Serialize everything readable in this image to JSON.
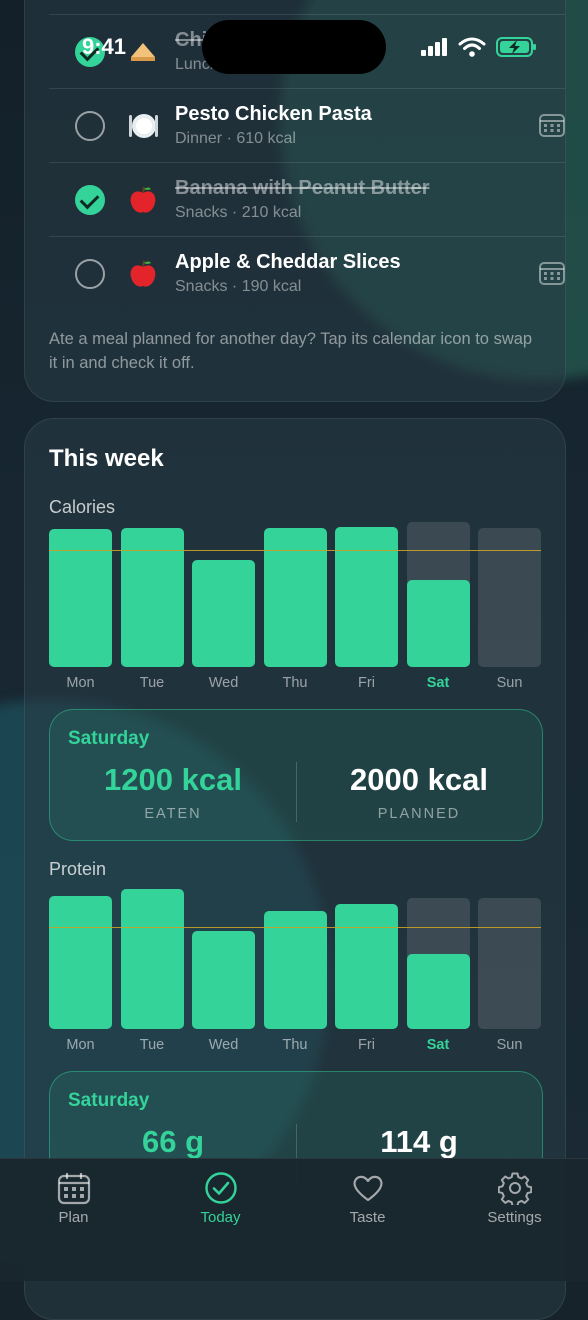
{
  "status_bar": {
    "time": "9:41"
  },
  "meals": [
    {
      "name": "Chicken",
      "sub": "Lunch ·",
      "done": true,
      "emoji": "sandwich-icon"
    },
    {
      "name": "Pesto Chicken Pasta",
      "sub": "Dinner · 610 kcal",
      "done": false,
      "emoji": "plate-icon",
      "calendar": true
    },
    {
      "name": "Banana with Peanut Butter",
      "sub": "Snacks · 210 kcal",
      "done": true,
      "emoji": "apple-icon"
    },
    {
      "name": "Apple & Cheddar Slices",
      "sub": "Snacks · 190 kcal",
      "done": false,
      "emoji": "apple-icon",
      "calendar": true
    }
  ],
  "hint": "Ate a meal planned for another day? Tap its calendar icon to swap it in and check it off.",
  "week": {
    "title": "This week",
    "calories_label": "Calories",
    "protein_label": "Protein",
    "today": "Sat"
  },
  "calories_summary": {
    "day": "Saturday",
    "eaten": "1200 kcal",
    "eaten_label": "EATEN",
    "planned": "2000 kcal",
    "planned_label": "PLANNED"
  },
  "protein_summary": {
    "day": "Saturday",
    "eaten": "66 g",
    "planned": "114 g"
  },
  "tabs": [
    {
      "label": "Plan",
      "icon": "calendar-icon",
      "active": false
    },
    {
      "label": "Today",
      "icon": "check-circle-icon",
      "active": true
    },
    {
      "label": "Taste",
      "icon": "heart-icon",
      "active": false
    },
    {
      "label": "Settings",
      "icon": "gear-icon",
      "active": false
    }
  ],
  "colors": {
    "accent": "#34d399",
    "goal_line": "#c9a227"
  },
  "chart_data": [
    {
      "type": "bar",
      "title": "Calories",
      "categories": [
        "Mon",
        "Tue",
        "Wed",
        "Thu",
        "Fri",
        "Sat",
        "Sun"
      ],
      "series": [
        {
          "name": "Eaten",
          "values": [
            1900,
            1910,
            1480,
            1910,
            1930,
            1200,
            0
          ]
        },
        {
          "name": "Planned",
          "values": [
            null,
            null,
            null,
            null,
            null,
            2000,
            1910
          ]
        }
      ],
      "goal": 1610,
      "ylim": [
        0,
        1930
      ]
    },
    {
      "type": "bar",
      "title": "Protein",
      "categories": [
        "Mon",
        "Tue",
        "Wed",
        "Thu",
        "Fri",
        "Sat",
        "Sun"
      ],
      "series": [
        {
          "name": "Eaten",
          "values": [
            101,
            106,
            74,
            89,
            95,
            57,
            0
          ]
        },
        {
          "name": "Planned",
          "values": [
            null,
            null,
            null,
            null,
            null,
            99,
            99
          ]
        }
      ],
      "goal": 77,
      "ylim": [
        0,
        106
      ]
    }
  ]
}
